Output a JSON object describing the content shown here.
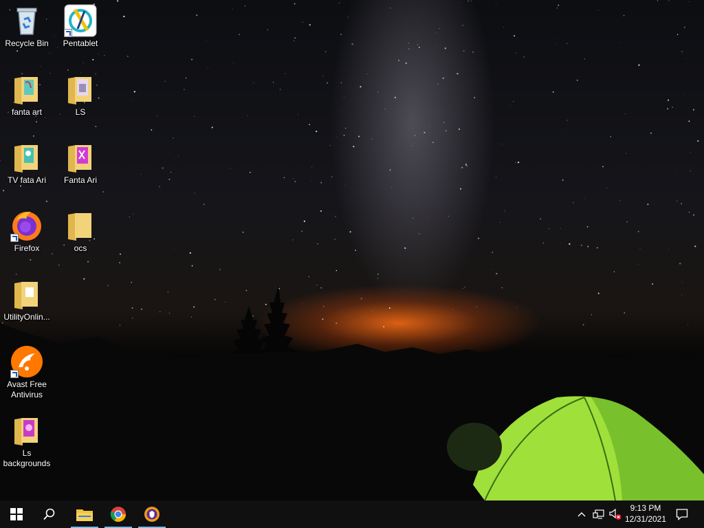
{
  "desktop": {
    "icons": [
      {
        "label": "Recycle Bin",
        "icon": "recycle-bin-icon"
      },
      {
        "label": "Pentablet",
        "icon": "pentablet-icon"
      },
      {
        "label": "fanta art",
        "icon": "folder-icon"
      },
      {
        "label": "LS",
        "icon": "folder-icon"
      },
      {
        "label": "TV  fata Ari",
        "icon": "folder-icon"
      },
      {
        "label": "Fanta Ari",
        "icon": "folder-icon"
      },
      {
        "label": "Firefox",
        "icon": "firefox-icon"
      },
      {
        "label": "ocs",
        "icon": "folder-icon"
      },
      {
        "label": "UtilityOnlin...",
        "icon": "folder-icon"
      },
      {
        "label": "Avast Free Antivirus",
        "icon": "avast-icon"
      },
      {
        "label": "Ls backgrounds",
        "icon": "folder-icon"
      }
    ]
  },
  "taskbar": {
    "pinned": [
      {
        "icon": "windows-start-icon"
      },
      {
        "icon": "search-icon"
      },
      {
        "icon": "file-explorer-icon"
      },
      {
        "icon": "chrome-icon"
      },
      {
        "icon": "avast-secure-browser-icon"
      }
    ],
    "tray": {
      "icons": [
        "chevron-up-icon",
        "network-icon",
        "volume-muted-icon",
        "notification-icon"
      ],
      "time": "9:13 PM",
      "date": "12/31/2021"
    }
  },
  "colors": {
    "taskbar_bg": "#101010",
    "active_indicator": "#76b9ed",
    "folder": "#f3d37a",
    "tent_green": "#9fe03a",
    "horizon_orange": "#ff6e14"
  }
}
